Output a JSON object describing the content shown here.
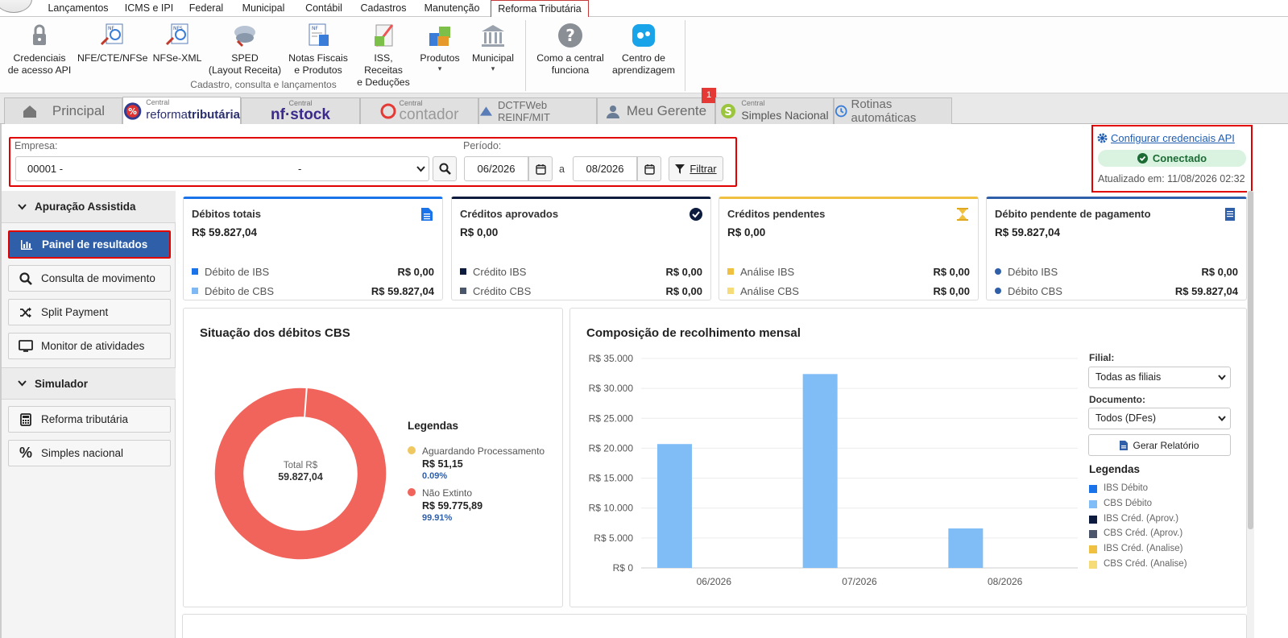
{
  "menu": {
    "tabs": [
      "Lançamentos",
      "ICMS e IPI",
      "Federal",
      "Municipal",
      "Contábil",
      "Cadastros",
      "Manutenção",
      "Reforma Tributária"
    ],
    "active": "Reforma Tributária"
  },
  "ribbon": {
    "buttons": [
      {
        "l1": "Credenciais",
        "l2": "de acesso API"
      },
      {
        "l1": "NFE/CTE/NFSe",
        "l2": ""
      },
      {
        "l1": "NFSe-XML",
        "l2": ""
      },
      {
        "l1": "SPED",
        "l2": "(Layout Receita)"
      },
      {
        "l1": "Notas Fiscais",
        "l2": "e Produtos"
      },
      {
        "l1": "ISS, Receitas",
        "l2": "e Deduções"
      },
      {
        "l1": "Produtos",
        "l2": "▾"
      },
      {
        "l1": "Municipal",
        "l2": "▾"
      },
      {
        "l1": "Como a central",
        "l2": "funciona"
      },
      {
        "l1": "Centro de",
        "l2": "aprendizagem"
      }
    ],
    "group_label": "Cadastro, consulta e lançamentos",
    "icon_labels": {
      "nfe": "NF",
      "nfse": "NFS",
      "nf": "NF"
    }
  },
  "central_tabs": {
    "principal": "Principal",
    "reforma_small": "Central",
    "reforma_main": "reforma",
    "reforma_bold": "tributária",
    "nfstock_small": "Central",
    "nfstock": "nf·stock",
    "contador_small": "Central",
    "contador": "contador",
    "dctf": "DCTFWeb REINF/MIT",
    "gerente": "Meu Gerente",
    "gerente_badge": "1",
    "simples_small": "Central",
    "simples": "Simples Nacional",
    "rotinas": "Rotinas automáticas"
  },
  "filter": {
    "empresa_label": "Empresa:",
    "empresa_code": "00001 -",
    "empresa_name": "-",
    "periodo_label": "Período:",
    "start": "06/2026",
    "sep": "a",
    "end": "08/2026",
    "filter_button": "Filtrar"
  },
  "credentials": {
    "link": "Configurar credenciais API",
    "status": "Conectado",
    "updated": "Atualizado em: 11/08/2026 02:32"
  },
  "sidebar": {
    "section1": "Apuração Assistida",
    "items1": [
      "Painel de resultados",
      "Consulta de movimento",
      "Split Payment",
      "Monitor de atividades"
    ],
    "section2": "Simulador",
    "items2": [
      "Reforma tributária",
      "Simples nacional"
    ]
  },
  "cards": [
    {
      "title": "Débitos totais",
      "value": "R$ 59.827,04",
      "accent": "#1a73e8",
      "rows": [
        {
          "label": "Débito de IBS",
          "value": "R$ 0,00",
          "color": "#1a73e8"
        },
        {
          "label": "Débito de CBS",
          "value": "R$ 59.827,04",
          "color": "#7fb9f5"
        }
      ]
    },
    {
      "title": "Créditos aprovados",
      "value": "R$ 0,00",
      "accent": "#0d1b3e",
      "rows": [
        {
          "label": "Crédito IBS",
          "value": "R$ 0,00",
          "color": "#0d1b3e"
        },
        {
          "label": "Crédito CBS",
          "value": "R$ 0,00",
          "color": "#4c566a"
        }
      ]
    },
    {
      "title": "Créditos pendentes",
      "value": "R$ 0,00",
      "accent": "#f0c040",
      "rows": [
        {
          "label": "Análise IBS",
          "value": "R$ 0,00",
          "color": "#f0c040"
        },
        {
          "label": "Análise CBS",
          "value": "R$ 0,00",
          "color": "#f6dc78"
        }
      ]
    },
    {
      "title": "Débito pendente de pagamento",
      "value": "R$ 59.827,04",
      "accent": "#2f5fa9",
      "rows": [
        {
          "label": "Débito IBS",
          "value": "R$ 0,00",
          "color": "#2f5fa9"
        },
        {
          "label": "Débito CBS",
          "value": "R$ 59.827,04",
          "color": "#2f5fa9"
        }
      ]
    }
  ],
  "donut": {
    "title": "Situação dos débitos CBS",
    "center_label": "Total R$",
    "center_value": "59.827,04",
    "legend_title": "Legendas",
    "items": [
      {
        "label": "Aguardando Processamento",
        "value": "R$ 51,15",
        "percent": "0.09%",
        "color": "#f0c862",
        "pct": 0.09
      },
      {
        "label": "Não Extinto",
        "value": "R$ 59.775,89",
        "percent": "99.91%",
        "color": "#f0645c",
        "pct": 99.91
      }
    ]
  },
  "chart_data": {
    "type": "bar",
    "title": "Composição de recolhimento mensal",
    "categories": [
      "06/2026",
      "07/2026",
      "08/2026"
    ],
    "series": [
      {
        "name": "CBS Débito",
        "values": [
          20700,
          32400,
          6600
        ],
        "color": "#80bdf7"
      }
    ],
    "ylim": [
      0,
      35000
    ],
    "yticks": [
      "R$ 0",
      "R$ 5.000",
      "R$ 10.000",
      "R$ 15.000",
      "R$ 20.000",
      "R$ 25.000",
      "R$ 30.000",
      "R$ 35.000"
    ],
    "grid": true
  },
  "bar_side": {
    "filial_label": "Filial:",
    "filial_value": "Todas as filiais",
    "doc_label": "Documento:",
    "doc_value": "Todos (DFes)",
    "report_button": "Gerar Relatório",
    "legend_title": "Legendas",
    "legend": [
      {
        "label": "IBS Débito",
        "color": "#1a73e8"
      },
      {
        "label": "CBS Débito",
        "color": "#80bdf7"
      },
      {
        "label": "IBS Créd. (Aprov.)",
        "color": "#0d1b3e"
      },
      {
        "label": "CBS Créd. (Aprov.)",
        "color": "#4c566a"
      },
      {
        "label": "IBS Créd. (Analise)",
        "color": "#f0c040"
      },
      {
        "label": "CBS Créd. (Analise)",
        "color": "#f6dc78"
      }
    ]
  }
}
